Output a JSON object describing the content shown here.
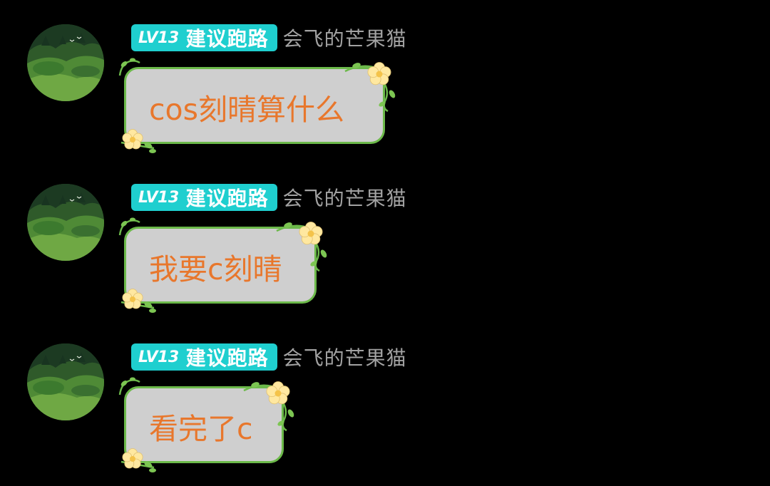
{
  "messages": [
    {
      "badge_level": "LV13",
      "badge_title": "建议跑路",
      "nickname": "会飞的芒果猫",
      "text": "cos刻晴算什么"
    },
    {
      "badge_level": "LV13",
      "badge_title": "建议跑路",
      "nickname": "会飞的芒果猫",
      "text": "我要c刻晴"
    },
    {
      "badge_level": "LV13",
      "badge_title": "建议跑路",
      "nickname": "会飞的芒果猫",
      "text": "看完了c"
    }
  ],
  "colors": {
    "background": "#000000",
    "badge_bg": "#1fcfcf",
    "nickname": "#a2a2a2",
    "bubble_bg": "#cfcfcf",
    "bubble_border": "#6cb94a",
    "bubble_text": "#e8772c",
    "flower": "#ffe8a0"
  },
  "icons": {
    "avatar": "forest-landscape-avatar",
    "bubble_decoration": "flower-vine-icon"
  }
}
